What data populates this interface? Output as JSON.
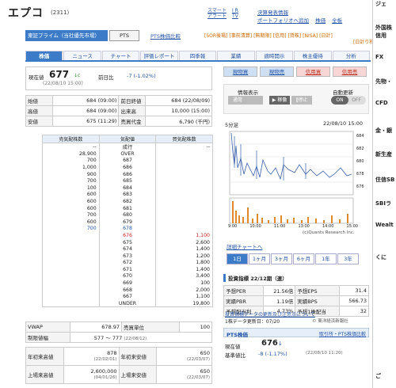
{
  "header": {
    "title": "エプコ",
    "code": "(2311)",
    "smart_alert": "スマート\nアラート",
    "ir": "I R\nTV",
    "links": [
      "決算発表情報",
      "ポートフォリオへ追加",
      "株価",
      "全板"
    ],
    "tags": [
      "[SOR後場]",
      "[事前清算]",
      "[無期限]",
      "[信用]",
      "[貸株]",
      "[NISA]",
      "[日計]",
      "[日計り株]"
    ],
    "market": "東証プライム（当社優先市場）",
    "pts": "PTS",
    "pts_diff": "PTS株価比較"
  },
  "tabs": [
    "株価",
    "ニュース",
    "チャート",
    "評価レポート",
    "四季報",
    "業績",
    "適時開示",
    "株主優待",
    "分析"
  ],
  "price": {
    "label": "現在値",
    "value": "677",
    "unit": "↓c",
    "date": "(22/08/10 15:00)",
    "prev_label": "前日比",
    "change": "-7 (-1.02%)"
  },
  "stats": [
    {
      "l1": "始値",
      "v1": "684",
      "t1": "(09:00)",
      "l2": "前日終値",
      "v2": "684",
      "t2": "(22/08/09)"
    },
    {
      "l1": "高値",
      "v1": "684",
      "t1": "(09:00)",
      "l2": "出来高",
      "v2": "10,000",
      "t2": "(15:00)"
    },
    {
      "l1": "安値",
      "v1": "675",
      "t1": "(11:29)",
      "l2": "売買代金",
      "v2": "6,790",
      "t2": "(千円)"
    }
  ],
  "book": {
    "headers": [
      "売気配株数",
      "気配値",
      "買気配株数"
    ],
    "rows": [
      [
        "--",
        "成行",
        "--"
      ],
      [
        "28,900",
        "OVER",
        ""
      ],
      [
        "700",
        "687",
        ""
      ],
      [
        "1,000",
        "686",
        ""
      ],
      [
        "900",
        "686",
        ""
      ],
      [
        "700",
        "685",
        ""
      ],
      [
        "100",
        "684",
        ""
      ],
      [
        "600",
        "683",
        ""
      ],
      [
        "600",
        "682",
        ""
      ],
      [
        "600",
        "681",
        ""
      ],
      [
        "700",
        "680",
        ""
      ],
      [
        "600",
        "679",
        ""
      ],
      [
        "700",
        "678",
        ""
      ],
      [
        "",
        "676",
        "1,100"
      ],
      [
        "",
        "675",
        "2,600"
      ],
      [
        "",
        "674",
        "1,400"
      ],
      [
        "",
        "673",
        "1,200"
      ],
      [
        "",
        "672",
        "1,800"
      ],
      [
        "",
        "671",
        "1,400"
      ],
      [
        "",
        "670",
        "3,400"
      ],
      [
        "",
        "669",
        "100"
      ],
      [
        "",
        "668",
        "2,000"
      ],
      [
        "",
        "667",
        "1,100"
      ],
      [
        "",
        "UNDER",
        "19,800"
      ]
    ]
  },
  "vwap": {
    "label": "VWAP",
    "value": "678.97",
    "unit_label": "売買単位",
    "unit": "100",
    "limit_label": "制限値幅",
    "limit": "577 〜 777",
    "limit_date": "(22/08/12)"
  },
  "hl": [
    {
      "l1": "年初来高値",
      "v1": "878",
      "d1": "(22/02/01)",
      "l2": "年初来安値",
      "v2": "650",
      "d2": "(22/03/07)"
    },
    {
      "l1": "上場来高値",
      "v1": "2,600,000",
      "d1": "(04/01/26)",
      "l2": "上場来安値",
      "v2": "650",
      "d2": "(22/03/07)"
    }
  ],
  "buttons": [
    "現物買",
    "現物売",
    "信用買",
    "信用売"
  ],
  "info": {
    "display": "情報表示",
    "display_opt": "通常",
    "refresh": "自動更新",
    "on": "ON",
    "off": "OFF",
    "play": "▶ 稼働",
    "stop": "‖停止"
  },
  "chart": {
    "label": "5分足",
    "datetime": "22/08/10 15:00",
    "yticks": [
      "684",
      "682",
      "680",
      "678",
      "676"
    ],
    "xticks": [
      "9:00",
      "10:00",
      "11:00",
      "13:00",
      "14:00",
      "15:00"
    ],
    "credit": "(c)Quants Research Inc."
  },
  "chart_link": "詳細チャートへ",
  "periods": [
    "1日",
    "1ヶ月",
    "3ヶ月",
    "6ヶ月",
    "1年",
    "3年"
  ],
  "indicators": {
    "title": "投資指標 22/12期（連）",
    "rows": [
      [
        "予想PER",
        "21.56倍",
        "予想EPS",
        "31.4"
      ],
      [
        "実績PBR",
        "1.19倍",
        "実績BPS",
        "566.73"
      ],
      [
        "予想配当利",
        "4.73%",
        "予想1株配当",
        "32"
      ]
    ],
    "note": "1株データ更新日：07/20",
    "source": "© 東洋経済新報社",
    "warning": "投資指標データの更新及び注意点について"
  },
  "pts_panel": {
    "title": "PTS株価",
    "link": "取引所・PTS株価比較",
    "label": "現在値",
    "value": "676",
    "arrow": "↓",
    "change_label": "基準値比",
    "change": "-8 (-1.17%)",
    "date": "(22/08/10 11:20)"
  },
  "side": [
    "ジェ",
    "外国株",
    "信用",
    "FX",
    "先物・",
    "CFD",
    "金・銀",
    "新生産",
    "住信SB",
    "SBIラ",
    "Wealt",
    "くに",
    "ご"
  ]
}
